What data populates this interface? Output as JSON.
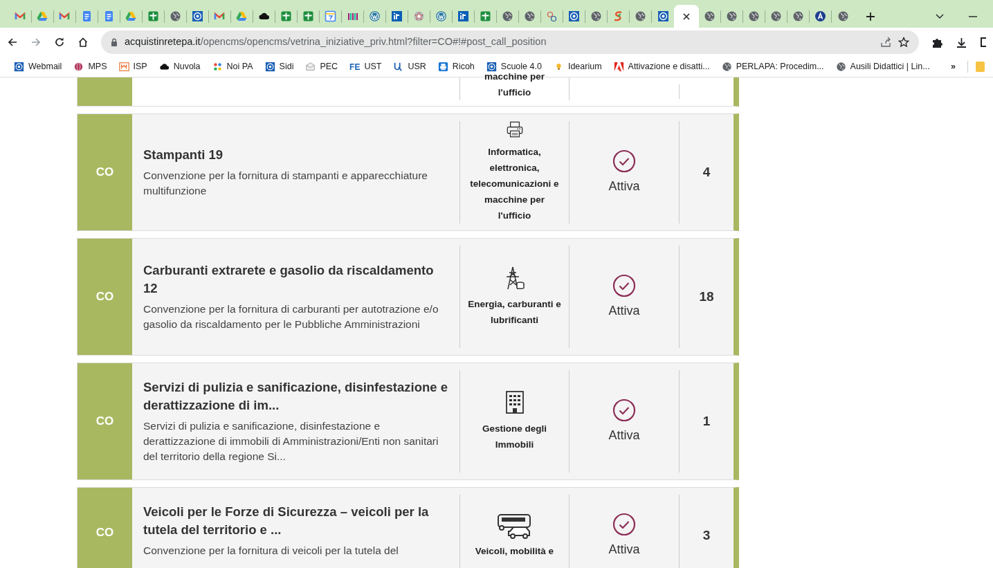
{
  "browser": {
    "tabs": [
      {
        "kind": "gmail",
        "selected": false
      },
      {
        "kind": "drive",
        "selected": false
      },
      {
        "kind": "gmail",
        "selected": false
      },
      {
        "kind": "docs",
        "selected": false
      },
      {
        "kind": "docs",
        "selected": false
      },
      {
        "kind": "drive",
        "selected": false
      },
      {
        "kind": "sheets",
        "selected": false
      },
      {
        "kind": "globe",
        "selected": false
      },
      {
        "kind": "seal",
        "selected": false
      },
      {
        "kind": "gmail",
        "selected": false
      },
      {
        "kind": "drive",
        "selected": false
      },
      {
        "kind": "cloud",
        "selected": false
      },
      {
        "kind": "sheets",
        "selected": false
      },
      {
        "kind": "sheets",
        "selected": false
      },
      {
        "kind": "calendar",
        "selected": false
      },
      {
        "kind": "stripes",
        "selected": false
      },
      {
        "kind": "wordpress",
        "selected": false
      },
      {
        "kind": "square",
        "selected": false
      },
      {
        "kind": "emblem",
        "selected": false
      },
      {
        "kind": "wordpress",
        "selected": false
      },
      {
        "kind": "square",
        "selected": false
      },
      {
        "kind": "sheets",
        "selected": false
      },
      {
        "kind": "globe",
        "selected": false
      },
      {
        "kind": "globe",
        "selected": false
      },
      {
        "kind": "dots",
        "selected": false
      },
      {
        "kind": "seal",
        "selected": false
      },
      {
        "kind": "globe",
        "selected": false
      },
      {
        "kind": "swirl",
        "selected": false
      },
      {
        "kind": "globe",
        "selected": false
      },
      {
        "kind": "seal",
        "selected": false
      },
      {
        "selected": true
      },
      {
        "kind": "globe",
        "selected": false
      },
      {
        "kind": "globe",
        "selected": false
      },
      {
        "kind": "globe",
        "selected": false
      },
      {
        "kind": "globe",
        "selected": false
      },
      {
        "kind": "globe",
        "selected": false
      },
      {
        "kind": "acircle",
        "selected": false
      },
      {
        "kind": "globe",
        "selected": false
      }
    ],
    "forward_disabled": true,
    "url_host": "acquistinretepa.it",
    "url_path": "/opencms/opencms/vetrina_iniziative_priv.html?filter=CO#!#post_call_position",
    "bookmarks": [
      {
        "kind": "seal",
        "label": "Webmail"
      },
      {
        "kind": "ball",
        "label": "MPS"
      },
      {
        "kind": "isp",
        "label": "ISP"
      },
      {
        "kind": "cloud",
        "label": "Nuvola"
      },
      {
        "kind": "pinwheel",
        "label": "Noi PA"
      },
      {
        "kind": "seal",
        "label": "Sidi"
      },
      {
        "kind": "envelope",
        "label": "PEC"
      },
      {
        "kind": "text",
        "logo_text": "FE",
        "label": "UST"
      },
      {
        "kind": "usr",
        "label": "USR"
      },
      {
        "kind": "printer",
        "label": "Ricoh"
      },
      {
        "kind": "seal",
        "label": "Scuole 4.0"
      },
      {
        "kind": "bulb",
        "label": "Idearium"
      },
      {
        "kind": "adobe",
        "label": "Attivazione e disatti..."
      },
      {
        "kind": "globe",
        "label": "PERLAPA: Procedim..."
      },
      {
        "kind": "globe",
        "label": "Ausili Didattici | Lin..."
      }
    ],
    "more_glyph": "»"
  },
  "initiatives": [
    {
      "partial": true,
      "category": "macchine per l'ufficio"
    },
    {
      "tag": "CO",
      "title": "Stampanti 19",
      "description": "Convenzione per la fornitura di stampanti e apparecchiature multifunzione",
      "kind": "printer",
      "category": "Informatica, elettronica, telecomunicazioni e macchine per l'ufficio",
      "status": "Attiva",
      "count": "4"
    },
    {
      "tag": "CO",
      "title": "Carburanti extrarete e gasolio da riscaldamento 12",
      "description": "Convenzione per la fornitura di carburanti per autotrazione e/o gasolio da riscaldamento per le Pubbliche Amministrazioni",
      "kind": "pylon",
      "category": "Energia, carburanti e lubrificanti",
      "status": "Attiva",
      "count": "18"
    },
    {
      "tag": "CO",
      "title": "Servizi di pulizia e sanificazione, disinfestazione e derattizzazione di im...",
      "description": "Servizi di pulizia e sanificazione, disinfestazione e derattizzazione di immobili di Amministrazioni/Enti non sanitari del territorio della regione Si...",
      "kind": "building",
      "category": "Gestione degli Immobili",
      "status": "Attiva",
      "count": "1"
    },
    {
      "tag": "CO",
      "title": "Veicoli per le Forze di Sicurezza – veicoli per la tutela del territorio e ...",
      "description": "Convenzione per la fornitura di veicoli per la tutela del",
      "kind": "vehicles",
      "category": "Veicoli, mobilità e",
      "status": "Attiva",
      "count": "3"
    }
  ]
}
